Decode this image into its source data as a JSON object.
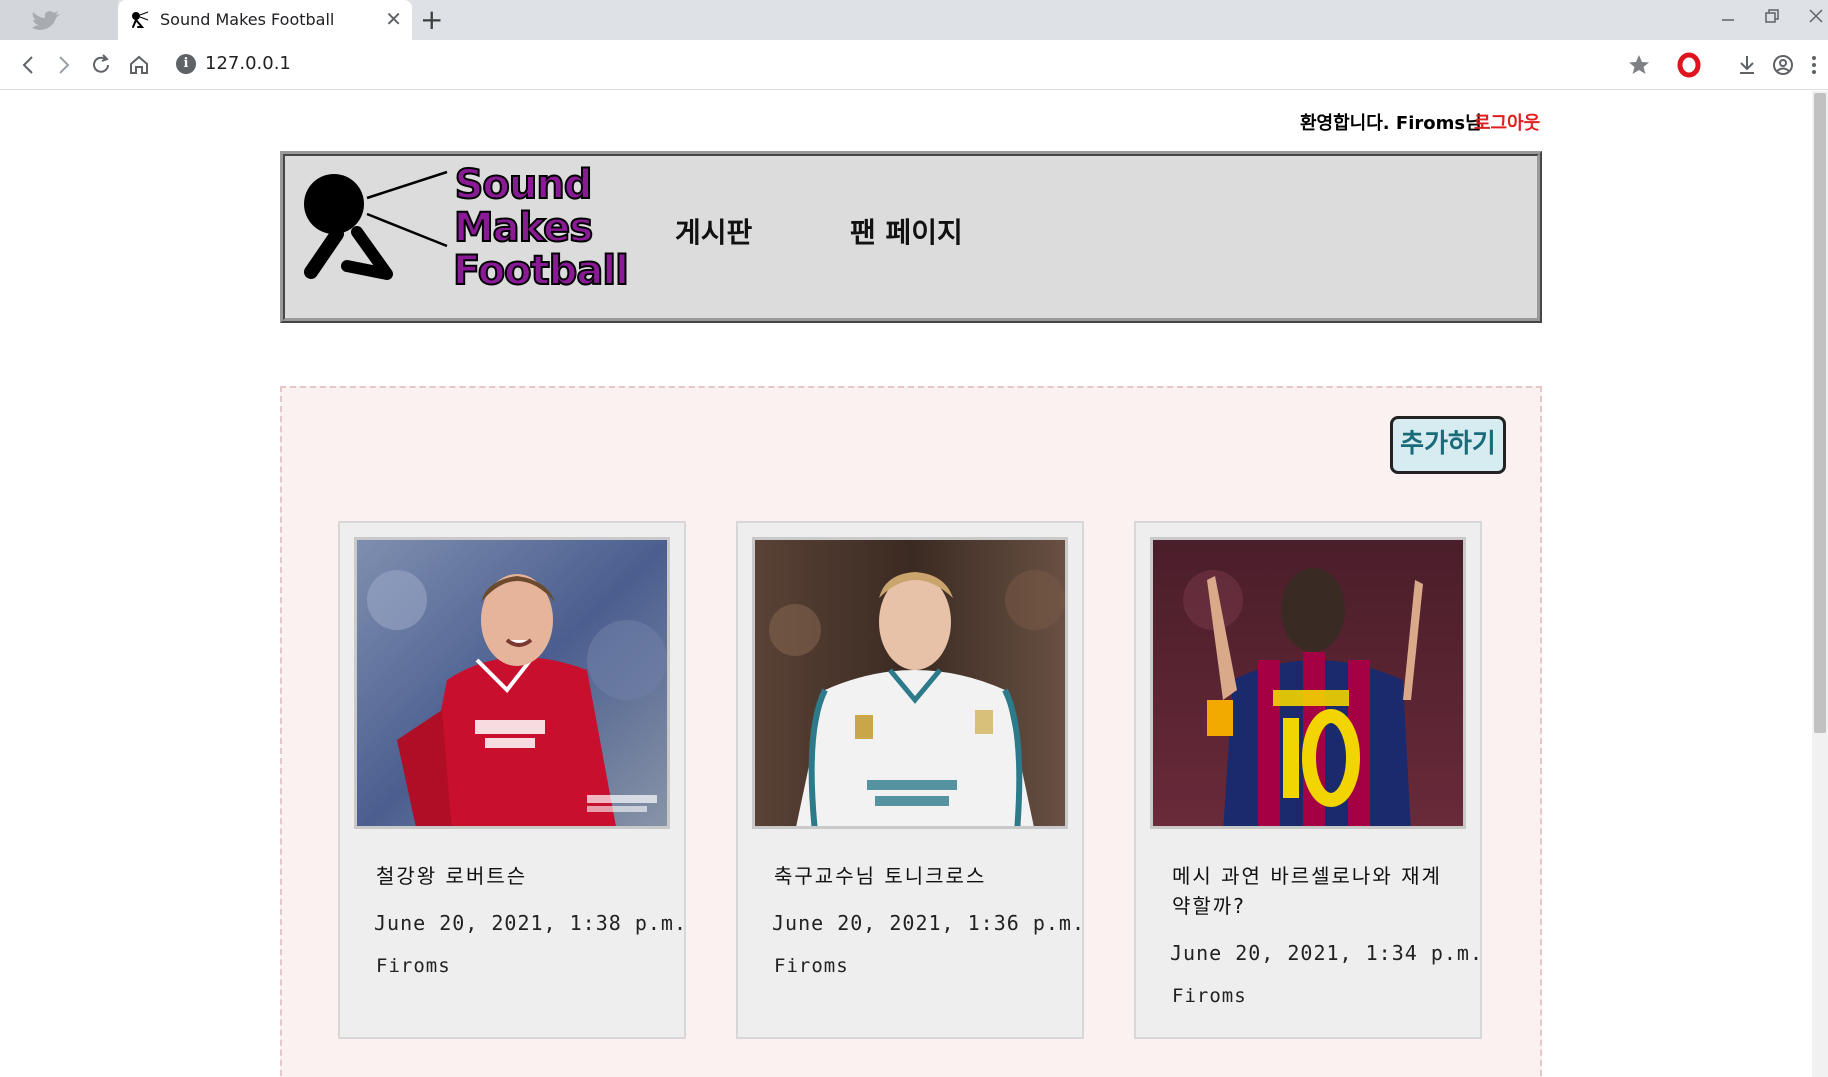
{
  "browser": {
    "tab_title": "Sound Makes Football",
    "url": "127.0.0.1",
    "new_tab_symbol": "+",
    "close_symbol": "✕"
  },
  "top_bar": {
    "welcome": "환영합니다. Firoms님",
    "logout": "로그아웃"
  },
  "header": {
    "logo_line1": "Sound",
    "logo_line2": "Makes",
    "logo_line3": "Football",
    "nav": [
      "게시판",
      "팬 페이지"
    ]
  },
  "board": {
    "add_button": "추가하기",
    "posts": [
      {
        "title": "철강왕 로버트슨",
        "date": "June 20, 2021, 1:38 p.m.",
        "author": "Firoms",
        "kit_color": "#c8102e"
      },
      {
        "title": "축구교수님 토니크로스",
        "date": "June 20, 2021, 1:36 p.m.",
        "author": "Firoms",
        "kit_color": "#f2f2f2"
      },
      {
        "title": "메시 과연 바르셀로나와 재계약할까?",
        "date": "June 20, 2021, 1:34 p.m.",
        "author": "Firoms",
        "kit_color": "#1a2a6c"
      }
    ]
  },
  "icons": [
    "back-icon",
    "forward-icon",
    "reload-icon",
    "home-icon",
    "info-icon",
    "star-icon",
    "opera-icon",
    "download-icon",
    "account-icon",
    "menu-icon"
  ]
}
